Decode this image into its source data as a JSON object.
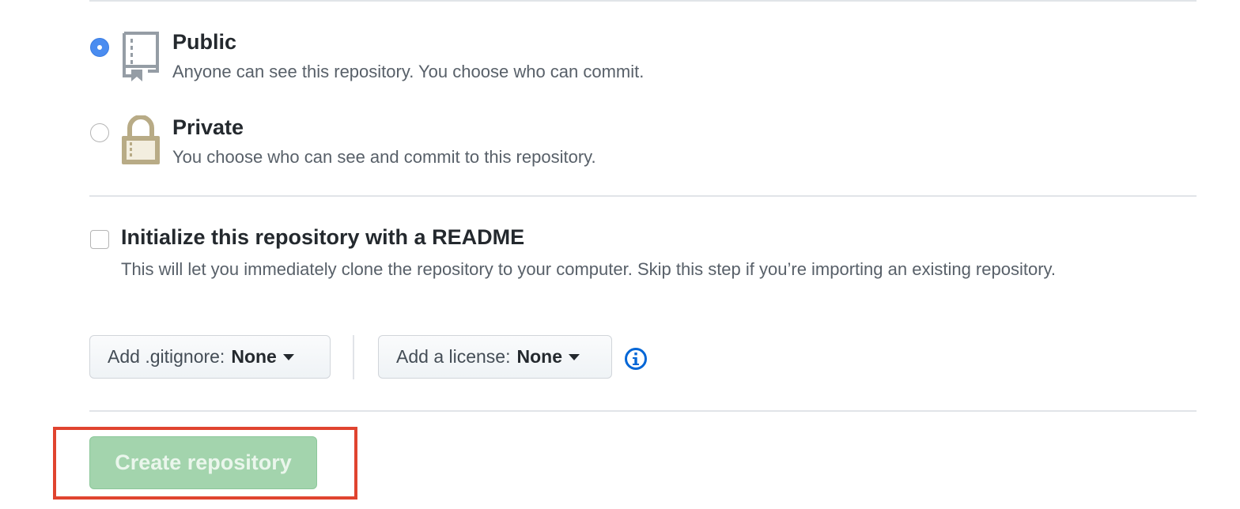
{
  "visibility": {
    "options": [
      {
        "title": "Public",
        "description": "Anyone can see this repository. You choose who can commit.",
        "icon": "repo-book-icon",
        "selected": true
      },
      {
        "title": "Private",
        "description": "You choose who can see and commit to this repository.",
        "icon": "lock-icon",
        "selected": false
      }
    ]
  },
  "readme": {
    "title": "Initialize this repository with a README",
    "description": "This will let you immediately clone the repository to your computer. Skip this step if you’re importing an existing repository.",
    "checked": false
  },
  "gitignore": {
    "label": "Add .gitignore:",
    "value": "None"
  },
  "license": {
    "label": "Add a license:",
    "value": "None"
  },
  "info_icon": "info-icon",
  "create_button": {
    "label": "Create repository",
    "disabled": true
  },
  "colors": {
    "radio_selected": "#4a8cf0",
    "button_disabled_green": "#a3d4ad",
    "highlight_border": "#e0442f",
    "info_blue": "#0366d6",
    "lock_tan": "#b8ab86"
  }
}
